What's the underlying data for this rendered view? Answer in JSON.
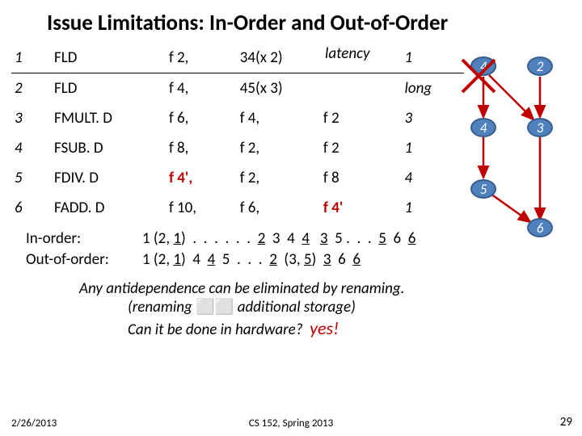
{
  "title": "Issue Limitations: In-Order and Out-of-Order",
  "latency_header": "latency",
  "table": {
    "rows": [
      {
        "n": "1",
        "op": "FLD",
        "d": "f 2,",
        "s1": "34(x 2)",
        "s2": "",
        "lat": "1"
      },
      {
        "n": "2",
        "op": "FLD",
        "d": "f 4,",
        "s1": "45(x 3)",
        "s2": "",
        "lat": "long"
      },
      {
        "n": "3",
        "op": "FMULT. D",
        "d": "f 6,",
        "s1": "f 4,",
        "s2": "f 2",
        "lat": "3"
      },
      {
        "n": "4",
        "op": "FSUB. D",
        "d": "f 8,",
        "s1": "f 2,",
        "s2": "f 2",
        "lat": "1"
      },
      {
        "n": "5",
        "op": "FDIV. D",
        "d": "f 4',",
        "s1": "f 2,",
        "s2": "f 8",
        "lat": "4"
      },
      {
        "n": "6",
        "op": "FADD. D",
        "d": "f 10,",
        "s1": "f 6,",
        "s2": "f 4'",
        "lat": "1"
      }
    ]
  },
  "orders": {
    "inorder_label": "In-order:",
    "inorder_seq": "1 (2, 1)  .  .  .  .  .  .  2  3  4  4   3  5 .  .  .  5  6  6",
    "outorder_label": "Out-of-order:",
    "outorder_seq": "1 (2, 1)  4  4  5  .  .  .  2  (3, 5)  3  6  6"
  },
  "bottom": {
    "line1": "Any antidependence can be eliminated by renaming.",
    "line2_a": "(renaming ",
    "line2_b": " additional storage)",
    "line3": "Can it be done in hardware?",
    "yes": "yes!"
  },
  "graph": {
    "nodes": {
      "n1": "1",
      "n2": "2",
      "n3": "3",
      "n4": "4",
      "n5": "5",
      "n6": "6"
    }
  },
  "footer": {
    "left": "2/26/2013",
    "center": "CS 152, Spring 2013",
    "right": "29"
  }
}
